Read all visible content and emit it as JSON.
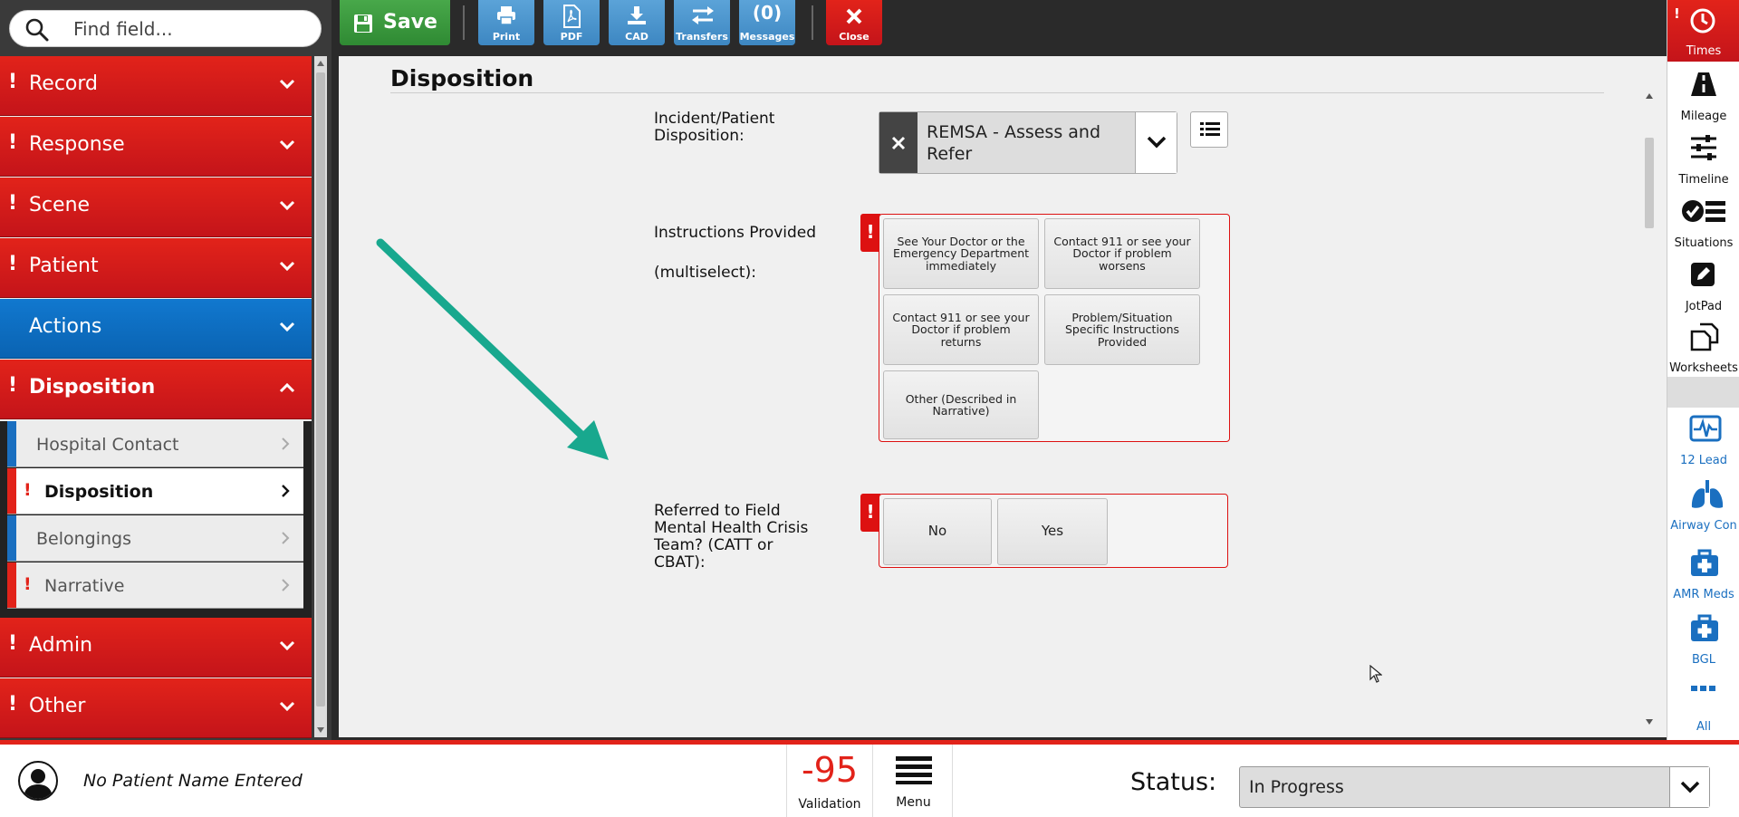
{
  "search": {
    "placeholder": "Find field..."
  },
  "sidebar": {
    "sections": [
      {
        "label": "Record",
        "required": true
      },
      {
        "label": "Response",
        "required": true
      },
      {
        "label": "Scene",
        "required": true
      },
      {
        "label": "Patient",
        "required": true
      },
      {
        "label": "Actions",
        "required": false
      },
      {
        "label": "Disposition",
        "required": true,
        "expanded": true
      }
    ],
    "subitems": [
      {
        "label": "Hospital Contact",
        "required": false
      },
      {
        "label": "Disposition",
        "required": true,
        "active": true
      },
      {
        "label": "Belongings",
        "required": false
      },
      {
        "label": "Narrative",
        "required": true
      }
    ],
    "lower_sections": [
      {
        "label": "Admin",
        "required": true
      },
      {
        "label": "Other",
        "required": true
      }
    ]
  },
  "toolbar": {
    "save": "Save",
    "print": "Print",
    "pdf": "PDF",
    "cad": "CAD",
    "transfers": "Transfers",
    "messages_count": "(0)",
    "messages": "Messages",
    "close": "Close"
  },
  "main": {
    "title": "Disposition",
    "disposition_label": "Incident/Patient Disposition:",
    "disposition_value": "REMSA - Assess and Refer",
    "instructions_label_1": "Instructions Provided",
    "instructions_label_2": "(multiselect):",
    "instructions_options": [
      "See Your Doctor or the Emergency Department immediately",
      "Contact 911 or see your Doctor if problem worsens",
      "Contact 911 or see your Doctor if problem returns",
      "Problem/Situation Specific Instructions Provided",
      "Other (Described in Narrative)"
    ],
    "referred_label": "Referred to Field Mental Health Crisis Team? (CATT or CBAT):",
    "referred_options": [
      "No",
      "Yes"
    ],
    "annotation_arrow_color": "#18a88e"
  },
  "right_sidebar": {
    "items": [
      {
        "label": "Times",
        "icon": "clock-icon"
      },
      {
        "label": "Mileage",
        "icon": "road-icon"
      },
      {
        "label": "Timeline",
        "icon": "sliders-icon"
      },
      {
        "label": "Situations",
        "icon": "check-list-icon"
      },
      {
        "label": "JotPad",
        "icon": "pencil-icon"
      },
      {
        "label": "Worksheets",
        "icon": "copy-icon"
      },
      {
        "label": "12 Lead",
        "icon": "ecg-monitor-icon"
      },
      {
        "label": "Airway Con",
        "icon": "lungs-icon"
      },
      {
        "label": "AMR Meds",
        "icon": "medkit-icon"
      },
      {
        "label": "BGL",
        "icon": "medkit-icon"
      },
      {
        "label": "All",
        "icon": "ellipsis-icon"
      }
    ]
  },
  "bottom": {
    "patient_name": "No Patient Name Entered",
    "validation_count": "-95",
    "validation_label": "Validation",
    "menu_label": "Menu",
    "status_label": "Status:",
    "status_value": "In Progress"
  },
  "colors": {
    "red": "#e2231a",
    "blue": "#1a6fc0",
    "green": "#3a9a3e"
  }
}
